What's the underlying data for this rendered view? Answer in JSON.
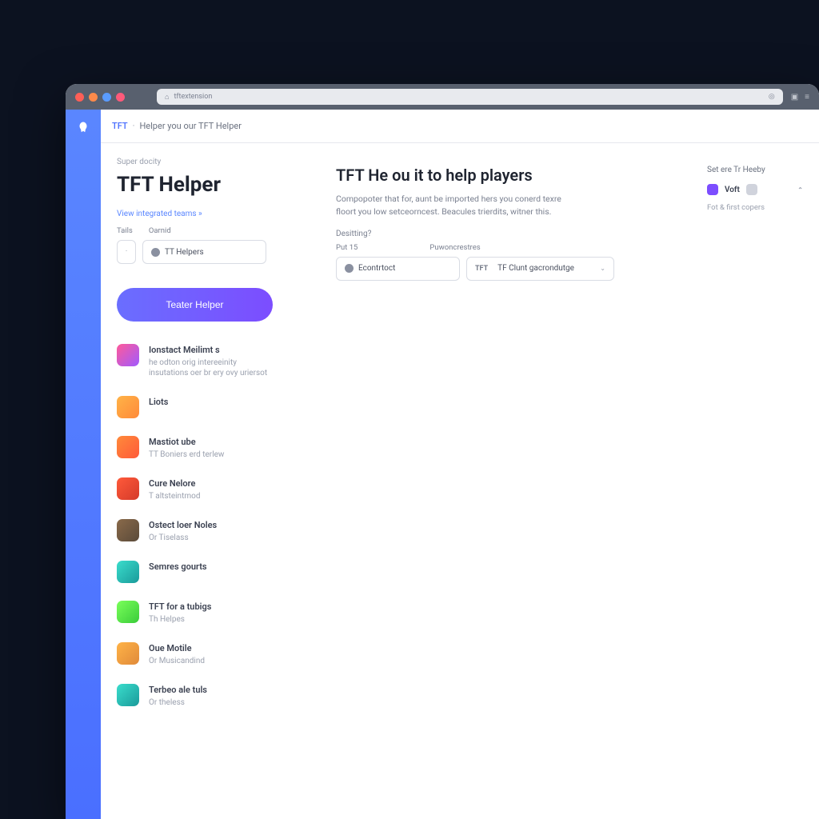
{
  "url": "tftextension",
  "breadcrumb": {
    "link": "TFT",
    "text": "Helper you our TFT Helper"
  },
  "left": {
    "eyebrow": "Super docity",
    "title": "TFT Helper",
    "link": "View integrated teams »",
    "filter_headers": [
      "Tails",
      "Oarnid"
    ],
    "filter1": "TT Helpers",
    "cta": "Teater Helper"
  },
  "center": {
    "heading": "TFT He ou it to help players",
    "description": "Compopoter that for, aunt be imported hers you conerd texre floort you low setceorncest. Beacules trierdits, witner this.",
    "detail_label": "Desitting?",
    "filter_headers": [
      "Put 15",
      "Puwoncrestres"
    ],
    "filter2": "Econtrtoct",
    "filter3_prefix": "TFT",
    "filter3": "TF Clunt gacrondutge"
  },
  "right": {
    "label": "Set ere Tr Heeby",
    "badge_text": "Voft",
    "link": "Fot & first copers"
  },
  "features": [
    {
      "title": "Ionstact Meilimt s",
      "sub": "he odton orig intereeinity insutations oer br ery ovy uriersot",
      "color": "linear-gradient(135deg,#ff5a9a,#a05aff)"
    },
    {
      "title": "Liots",
      "sub": "",
      "color": "linear-gradient(135deg,#ffb347,#ff8a3a)"
    },
    {
      "title": "Mastiot ube",
      "sub": "TT Boniers erd terlew",
      "color": "linear-gradient(135deg,#ff8a3a,#ff5a3a)"
    },
    {
      "title": "Cure Nelore",
      "sub": "T altsteintmod",
      "color": "linear-gradient(135deg,#ff5a3a,#d43a2a)"
    },
    {
      "title": "Ostect loer Noles",
      "sub": "Or Tiselass",
      "color": "linear-gradient(135deg,#8a6a4a,#5a4a3a)"
    },
    {
      "title": "Semres gourts",
      "sub": "",
      "color": "linear-gradient(135deg,#3addcc,#1a9a9a)"
    },
    {
      "title": "TFT for a tubigs",
      "sub": "Th Helpes",
      "color": "linear-gradient(135deg,#7aff5a,#3acc3a)"
    },
    {
      "title": "Oue Motile",
      "sub": "Or Musicandind",
      "color": "linear-gradient(135deg,#ffb347,#e08a3a)"
    },
    {
      "title": "Terbeo ale tuls",
      "sub": "Or theless",
      "color": "linear-gradient(135deg,#3addcc,#1a9a9a)"
    }
  ]
}
